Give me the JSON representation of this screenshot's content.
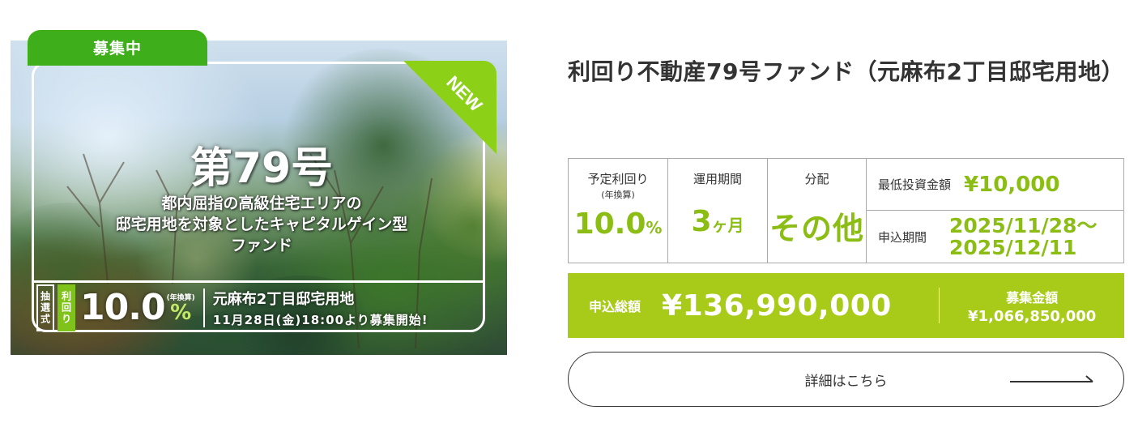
{
  "image_card": {
    "status_tab": "募集中",
    "new_badge": "NEW",
    "fund_number": "第79号",
    "tagline": [
      "都内屈指の高級住宅エリアの",
      "邸宅用地を対象としたキャピタルゲイン型",
      "ファンド"
    ],
    "method": "抽選式",
    "yield_tag": "利回り",
    "rate": "10.0",
    "rate_note": "(年換算)",
    "rate_pct": "%",
    "location": "元麻布2丁目邸宅用地",
    "start": "11月28日(金)18:00より募集開始!"
  },
  "fund": {
    "title": "利回り不動産79号ファンド（元麻布2丁目邸宅用地）"
  },
  "info": {
    "yield_label": "予定利回り",
    "yield_sub": "(年換算)",
    "yield_value": "10.0",
    "yield_unit": "%",
    "period_label": "運用期間",
    "period_value": "3",
    "period_unit": "ヶ月",
    "dist_label": "分配",
    "dist_value": "その他",
    "min_label": "最低投資金額",
    "min_value": "¥10,000",
    "app_label": "申込期間",
    "app_start": "2025/11/28～",
    "app_end": "2025/12/11"
  },
  "totals": {
    "applied_label": "申込総額",
    "applied_value": "¥136,990,000",
    "target_label": "募集金額",
    "target_value": "¥1,066,850,000"
  },
  "detail_button": {
    "label": "詳細はこちら"
  },
  "colors": {
    "tab_green": "#3fae1b",
    "accent_green": "#8bbd15",
    "bar_green": "#a8ca19"
  },
  "icons": {
    "arrow": "long-right-arrow-icon"
  }
}
